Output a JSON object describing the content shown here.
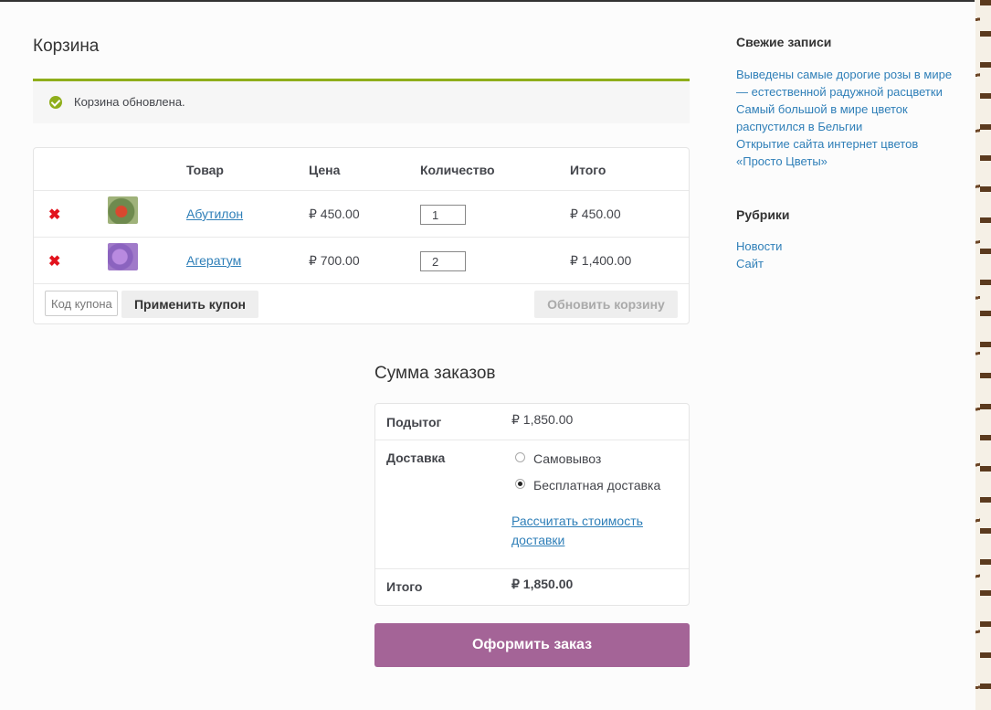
{
  "page_title": "Корзина",
  "notice": {
    "message": "Корзина обновлена."
  },
  "cart": {
    "headers": {
      "product": "Товар",
      "price": "Цена",
      "quantity": "Количество",
      "total": "Итого"
    },
    "remove_symbol": "✖",
    "items": [
      {
        "name": "Абутилон",
        "price": "₽ 450.00",
        "quantity": "1",
        "total": "₽ 450.00"
      },
      {
        "name": "Агератум",
        "price": "₽ 700.00",
        "quantity": "2",
        "total": "₽ 1,400.00"
      }
    ],
    "coupon_placeholder": "Код купона",
    "apply_coupon_label": "Применить купон",
    "update_cart_label": "Обновить корзину"
  },
  "totals": {
    "title": "Сумма заказов",
    "subtotal_label": "Подытог",
    "subtotal_value": "₽ 1,850.00",
    "shipping_label": "Доставка",
    "shipping_options": [
      {
        "label": "Самовывоз",
        "selected": false
      },
      {
        "label": "Бесплатная доставка",
        "selected": true
      }
    ],
    "calc_shipping_label": "Рассчитать стоимость доставки",
    "total_label": "Итого",
    "total_value": "₽ 1,850.00"
  },
  "checkout_label": "Оформить заказ",
  "sidebar": {
    "recent_posts_title": "Свежие записи",
    "recent_posts": [
      "Выведены самые дорогие розы в мире — естественной радужной расцветки",
      "Самый большой в мире цветок распустился в Бельгии",
      "Открытие сайта интернет цветов «Просто Цветы»"
    ],
    "categories_title": "Рубрики",
    "categories": [
      "Новости",
      "Сайт"
    ]
  },
  "colors": {
    "accent": "#a46497",
    "link": "#2f7fb8",
    "success": "#8fae1b",
    "remove": "#e2131d"
  }
}
